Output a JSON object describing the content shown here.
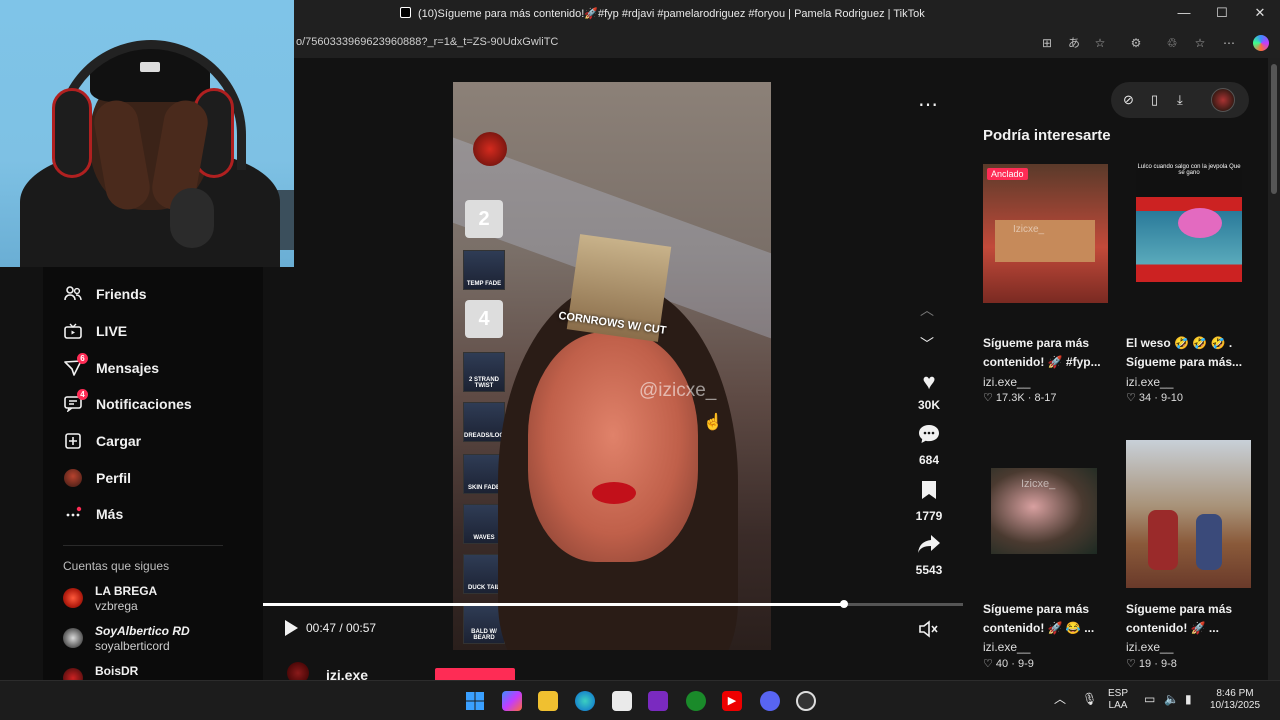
{
  "browser": {
    "tab_title": "(10)Sígueme para más contenido!🚀#fyp #rdjavi #pamelarodriguez #foryou | Pamela Rodriguez | TikTok",
    "url": "o/7560333969623960888?_r=1&_t=ZS-90UdxGwliTC",
    "minimize": "—",
    "maximize": "☐",
    "close": "✕"
  },
  "sidebar": {
    "items": [
      {
        "label": "Friends",
        "icon": "friends-icon",
        "badge": ""
      },
      {
        "label": "LIVE",
        "icon": "live-icon",
        "badge": ""
      },
      {
        "label": "Mensajes",
        "icon": "messages-icon",
        "badge": "6"
      },
      {
        "label": "Notificaciones",
        "icon": "notifications-icon",
        "badge": "4"
      },
      {
        "label": "Cargar",
        "icon": "upload-icon",
        "badge": ""
      },
      {
        "label": "Perfil",
        "icon": "profile-icon",
        "badge": ""
      },
      {
        "label": "Más",
        "icon": "more-icon",
        "badge": ""
      }
    ],
    "following_title": "Cuentas que sigues",
    "following": [
      {
        "name": "LA BREGA",
        "handle": "vzbrega"
      },
      {
        "name": "SoyAlbertico RD",
        "handle": "soyalberticord"
      },
      {
        "name": "BoisDR",
        "handle": ""
      }
    ]
  },
  "video": {
    "watermark": "@izicxe_",
    "ranks": [
      "2",
      "4"
    ],
    "overlay_label": "CORNROWS W/ CUT",
    "thumb_labels": [
      "TEMP FADE",
      "2 STRAND TWIST",
      "DREADS/LOCS",
      "SKIN FADE",
      "WAVES",
      "DUCK TAIL",
      "BALD W/ BEARD"
    ],
    "time": "00:47 / 00:57",
    "progress": 0.83,
    "author_partial": "izi.exe"
  },
  "actions": {
    "likes": "30K",
    "comments": "684",
    "saves": "1779",
    "shares": "5543"
  },
  "recommendations": {
    "title": "Podría interesarte",
    "pinned_label": "Anclado",
    "cards": [
      {
        "caption": "Sígueme para más contenido! 🚀 #fyp...",
        "user": "izi.exe__",
        "likes": "17.3K",
        "date": "8-17"
      },
      {
        "caption": "El weso 🤣 🤣 🤣 . Sígueme para más...",
        "user": "izi.exe__",
        "likes": "34",
        "date": "9-10"
      },
      {
        "caption": "Sígueme para más contenido! 🚀 😂 ...",
        "user": "izi.exe__",
        "likes": "40",
        "date": "9-9"
      },
      {
        "caption": "Sígueme para más contenido! 🚀 ...",
        "user": "izi.exe__",
        "likes": "19",
        "date": "9-8"
      }
    ],
    "card2_overlay": "Lulco cuando salgo con la jevpola Que se gano",
    "card_watermark": "Izicxe_"
  },
  "taskbar": {
    "lang_top": "ESP",
    "lang_bottom": "LAA",
    "time": "8:46 PM",
    "date": "10/13/2025"
  },
  "colors": {
    "accent": "#fe2c55",
    "page_bg": "#121212",
    "sidebar_bg": "#0b0b0b"
  }
}
